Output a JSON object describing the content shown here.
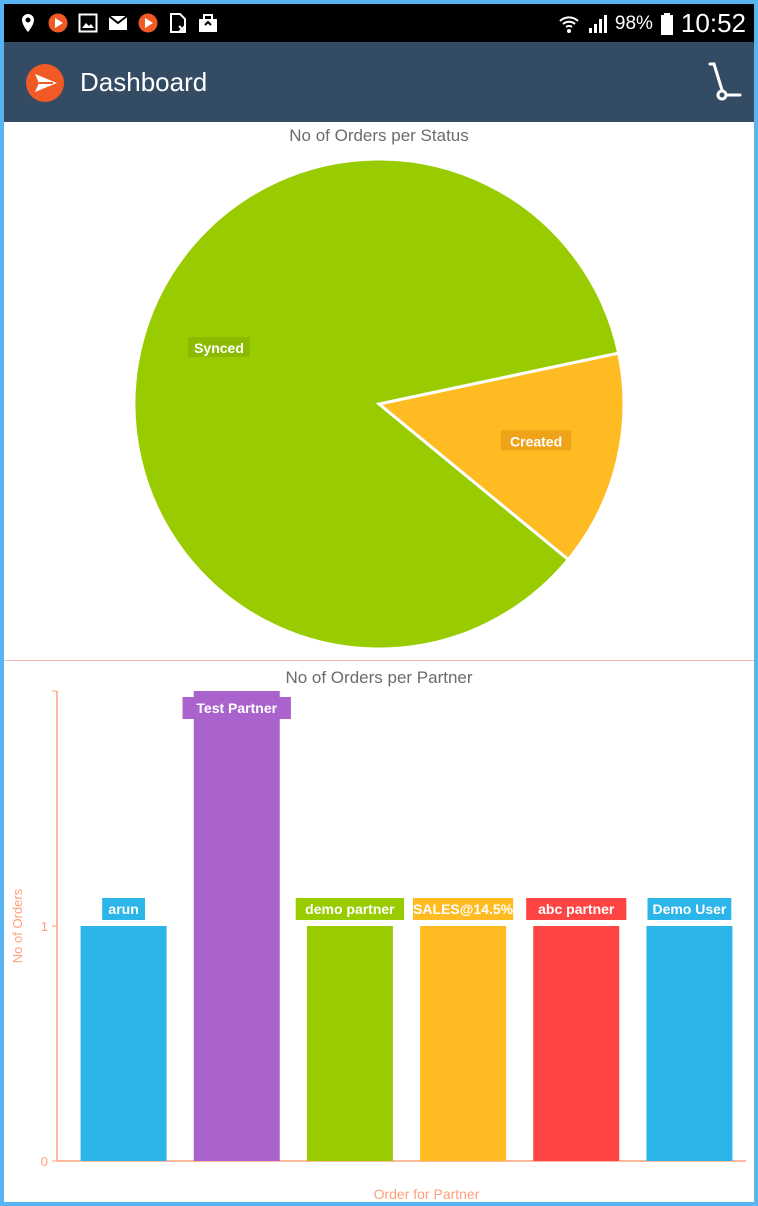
{
  "status_bar": {
    "battery": "98%",
    "time": "10:52",
    "icons": [
      "location-icon",
      "play-icon",
      "gallery-icon",
      "mail-icon",
      "play-icon",
      "sim-icon",
      "briefcase-icon",
      "wifi-icon",
      "signal-icon",
      "battery-icon"
    ]
  },
  "app_bar": {
    "title": "Dashboard",
    "logo_icon": "paper-plane-icon",
    "action_icon": "hand-truck-icon",
    "colors": {
      "bar": "#344b64",
      "logo": "#f15a24"
    }
  },
  "charts": {
    "status_title": "No of Orders per Status",
    "partner_title": "No of Orders per Partner"
  },
  "chart_data": [
    {
      "type": "pie",
      "title": "No of Orders per Status",
      "categories": [
        "Synced",
        "Created"
      ],
      "values": [
        6,
        1
      ],
      "colors": [
        "#99cc00",
        "#ffbb22"
      ]
    },
    {
      "type": "bar",
      "title": "No of Orders per Partner",
      "categories": [
        "arun",
        "Test Partner",
        "demo partner",
        "SALES@14.5%",
        "abc partner",
        "Demo User"
      ],
      "values": [
        1,
        2,
        1,
        1,
        1,
        1
      ],
      "colors": [
        "#2cb5e8",
        "#aa63cc",
        "#99cc00",
        "#ffbb22",
        "#ff4444",
        "#2cb5e8"
      ],
      "xlabel": "Order for Partner",
      "ylabel": "No of Orders",
      "yticks": [
        "0",
        "1"
      ],
      "ylim": [
        0,
        2
      ]
    }
  ]
}
